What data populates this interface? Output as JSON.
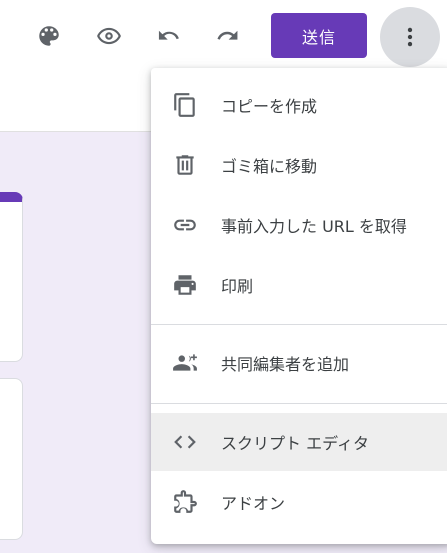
{
  "toolbar": {
    "icons": [
      "palette-icon",
      "preview-eye-icon",
      "undo-icon",
      "redo-icon"
    ],
    "send_label": "送信",
    "more_icon": "more-vert-icon"
  },
  "colors": {
    "accent": "#673ab7",
    "background": "#f0ebf8",
    "highlight": "#eeeeee"
  },
  "menu": {
    "items": [
      {
        "icon": "copy-icon",
        "label": "コピーを作成"
      },
      {
        "icon": "trash-icon",
        "label": "ゴミ箱に移動"
      },
      {
        "icon": "link-icon",
        "label": "事前入力した URL を取得"
      },
      {
        "icon": "print-icon",
        "label": "印刷"
      },
      {
        "icon": "add-collaborators-icon",
        "label": "共同編集者を追加"
      },
      {
        "icon": "code-icon",
        "label": "スクリプト エディタ"
      },
      {
        "icon": "puzzle-icon",
        "label": "アドオン"
      }
    ]
  }
}
